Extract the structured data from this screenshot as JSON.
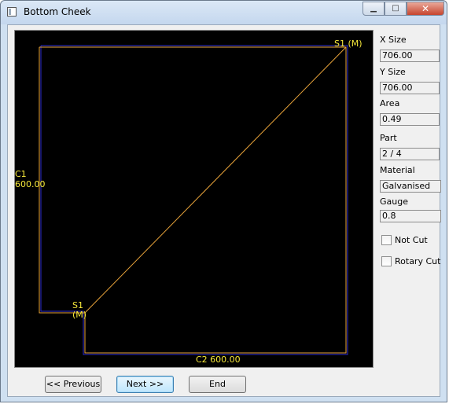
{
  "window": {
    "title": "Bottom Cheek"
  },
  "drawing": {
    "labels": {
      "s1_top": "S1 (M)",
      "c1": "C1",
      "c1_value": "600.00",
      "s1_bottom": "S1",
      "s1_bottom_m": "(M)",
      "c2": "C2 600.00"
    },
    "colors": {
      "outline": "#e8a33a",
      "inner": "#2b2bd0",
      "text": "#f5e73a",
      "background": "#000000"
    }
  },
  "fields": {
    "x_size": {
      "label": "X Size",
      "value": "706.00"
    },
    "y_size": {
      "label": "Y Size",
      "value": "706.00"
    },
    "area": {
      "label": "Area",
      "value": "0.49"
    },
    "part": {
      "label": "Part",
      "value": "2 / 4"
    },
    "material": {
      "label": "Material",
      "value": "Galvanised"
    },
    "gauge": {
      "label": "Gauge",
      "value": "0.8"
    }
  },
  "checkboxes": {
    "not_cut": {
      "label": "Not Cut",
      "checked": false
    },
    "rotary_cut": {
      "label": "Rotary Cut",
      "checked": false
    }
  },
  "buttons": {
    "previous": "<< Previous",
    "next": "Next >>",
    "end": "End"
  }
}
